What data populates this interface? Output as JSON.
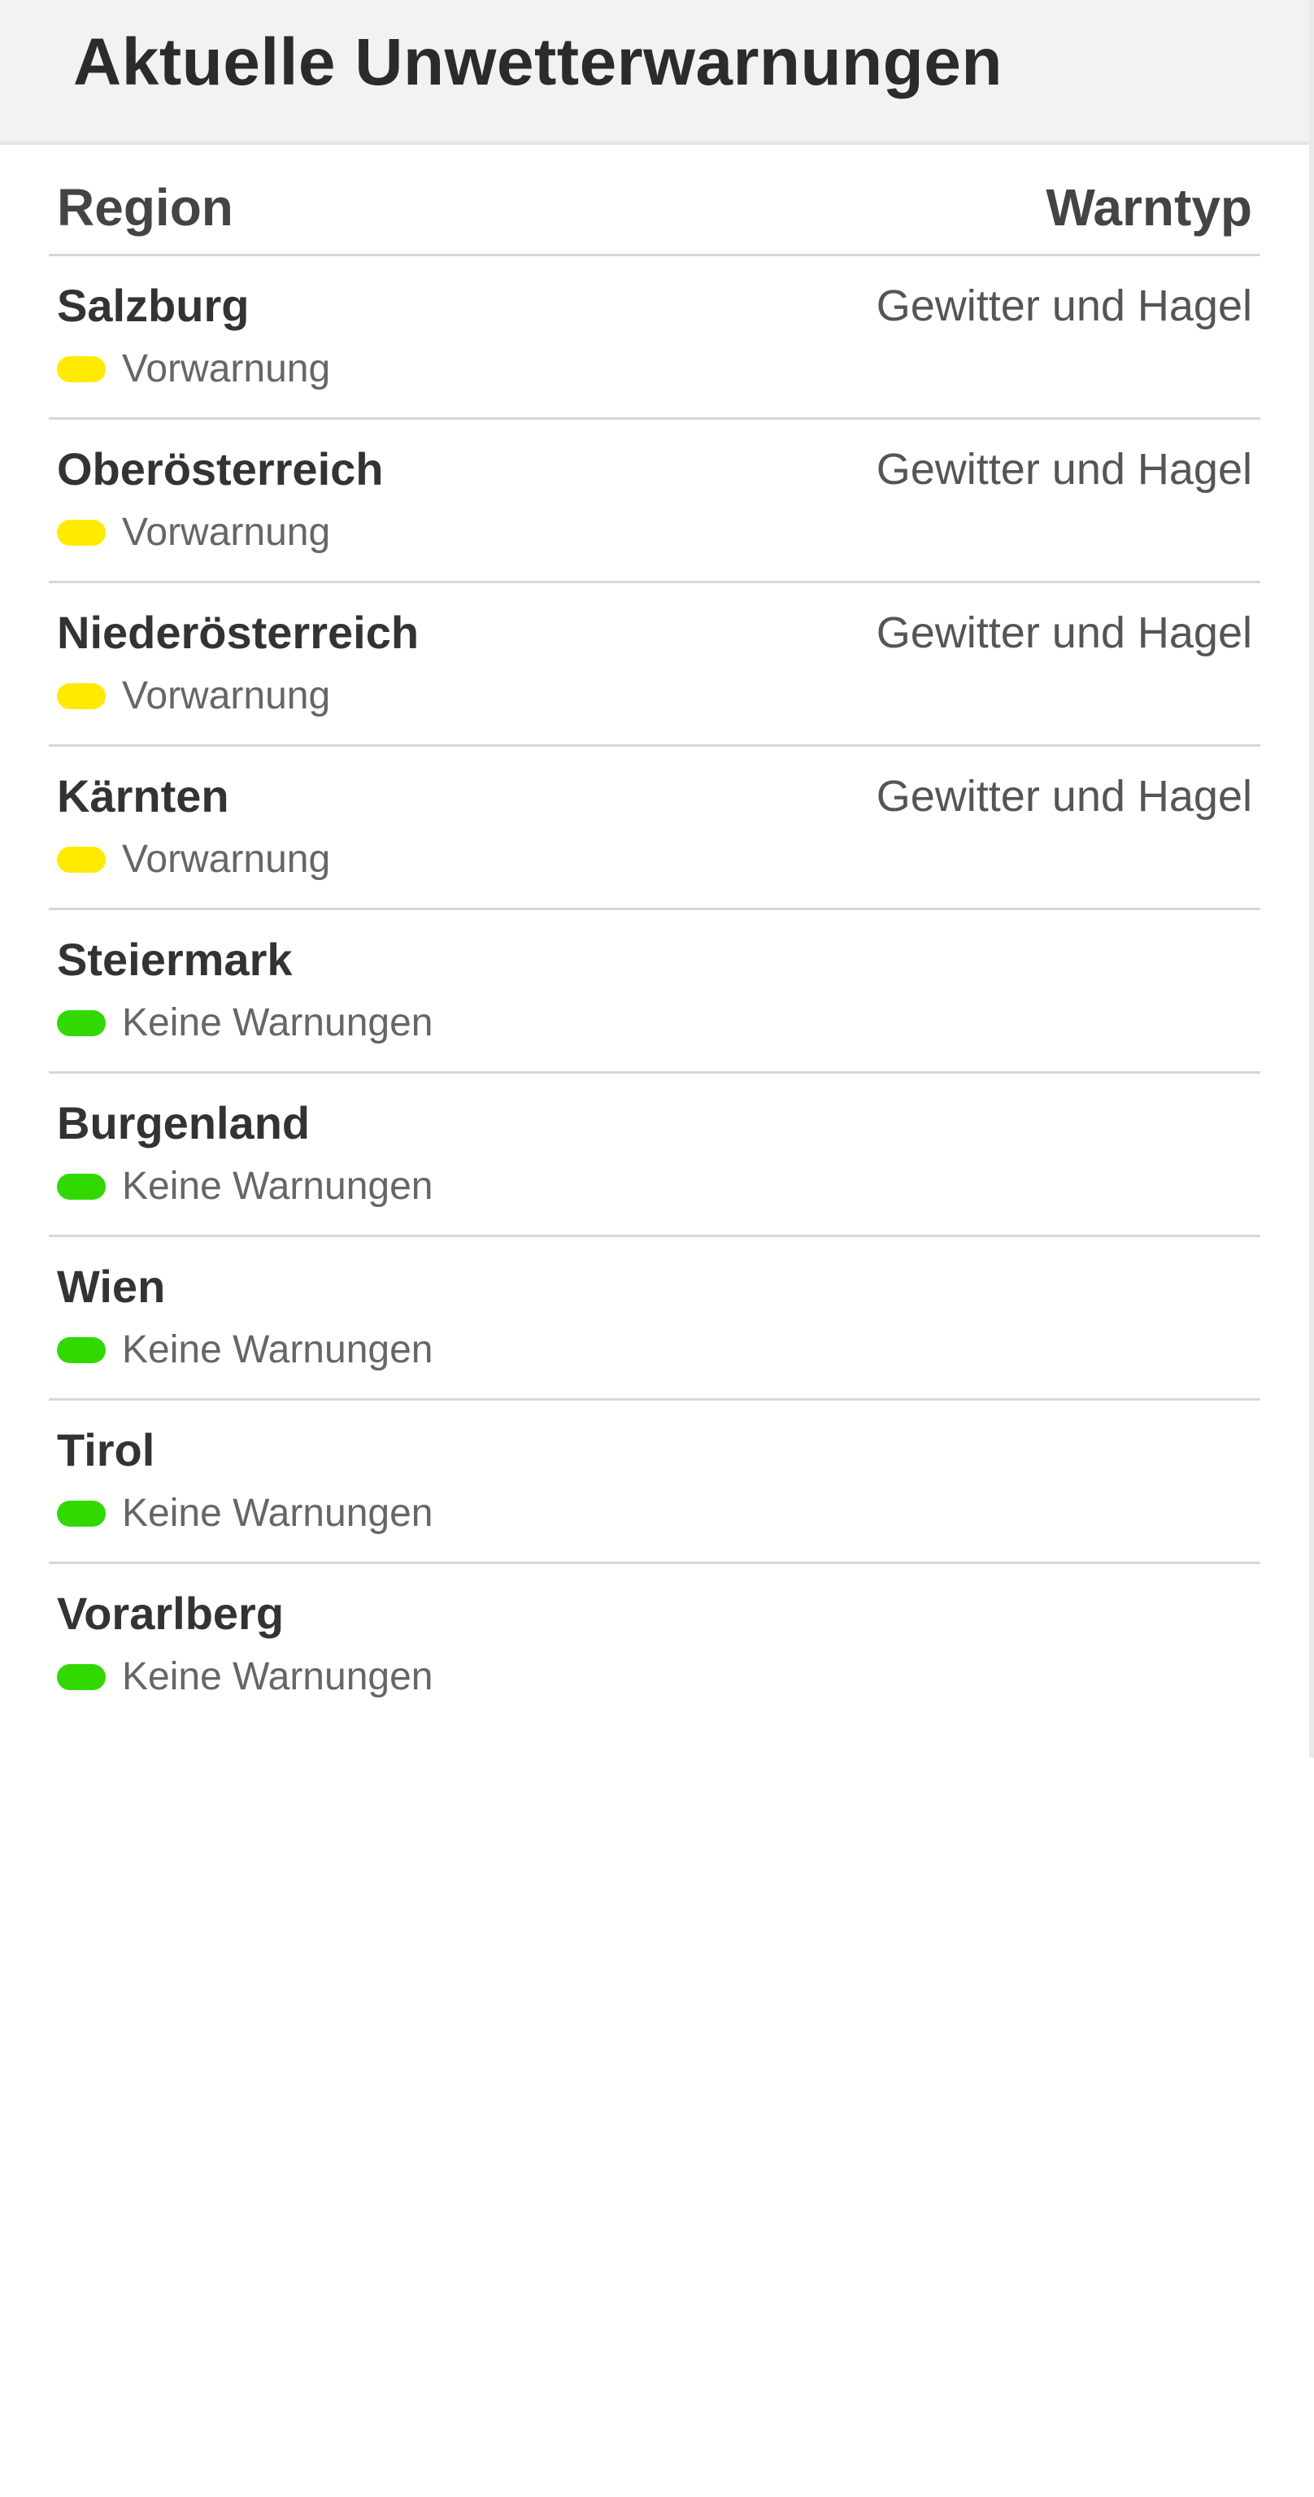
{
  "panel": {
    "title": "Aktuelle Unwetterwarnungen"
  },
  "columns": {
    "region": "Region",
    "warntyp": "Warntyp"
  },
  "status_labels": {
    "vorwarnung": "Vorwarnung",
    "keine": "Keine Warnungen"
  },
  "status_colors": {
    "vorwarnung": "#ffea00",
    "keine": "#31d900"
  },
  "rows": [
    {
      "region": "Salzburg",
      "status": "vorwarnung",
      "status_label": "Vorwarnung",
      "warntyp": "Gewitter und Hagel"
    },
    {
      "region": "Oberösterreich",
      "status": "vorwarnung",
      "status_label": "Vorwarnung",
      "warntyp": "Gewitter und Hagel"
    },
    {
      "region": "Niederösterreich",
      "status": "vorwarnung",
      "status_label": "Vorwarnung",
      "warntyp": "Gewitter und Hagel"
    },
    {
      "region": "Kärnten",
      "status": "vorwarnung",
      "status_label": "Vorwarnung",
      "warntyp": "Gewitter und Hagel"
    },
    {
      "region": "Steiermark",
      "status": "keine",
      "status_label": "Keine Warnungen",
      "warntyp": ""
    },
    {
      "region": "Burgenland",
      "status": "keine",
      "status_label": "Keine Warnungen",
      "warntyp": ""
    },
    {
      "region": "Wien",
      "status": "keine",
      "status_label": "Keine Warnungen",
      "warntyp": ""
    },
    {
      "region": "Tirol",
      "status": "keine",
      "status_label": "Keine Warnungen",
      "warntyp": ""
    },
    {
      "region": "Vorarlberg",
      "status": "keine",
      "status_label": "Keine Warnungen",
      "warntyp": ""
    }
  ]
}
